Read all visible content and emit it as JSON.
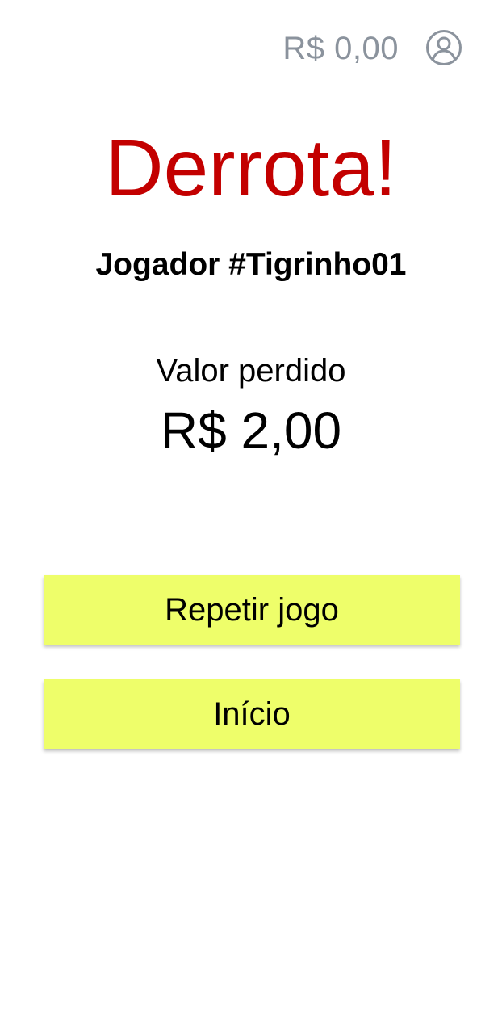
{
  "header": {
    "balance": "R$ 0,00",
    "profile_icon": "user-circle-icon",
    "icon_color": "#8b939d"
  },
  "result": {
    "title": "Derrota!",
    "title_color": "#c30000",
    "player": "Jogador #Tigrinho01",
    "amount_label": "Valor perdido",
    "amount_value": "R$ 2,00"
  },
  "actions": {
    "repeat_label": "Repetir jogo",
    "home_label": "Início",
    "button_color": "#eefe6a"
  }
}
